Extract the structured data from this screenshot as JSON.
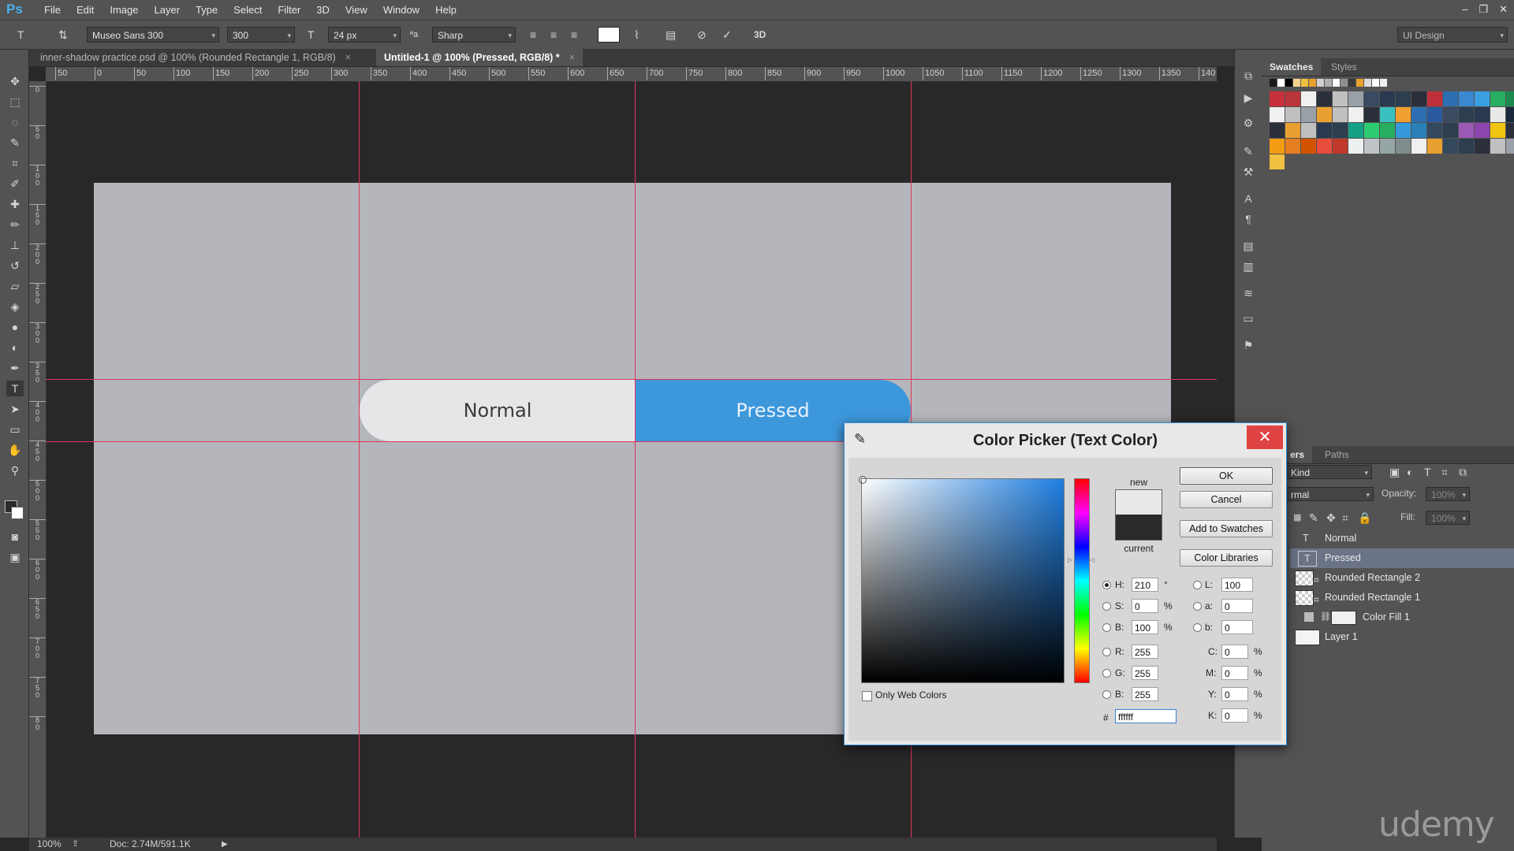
{
  "app": {
    "logo": "Ps",
    "menu": [
      "File",
      "Edit",
      "Image",
      "Layer",
      "Type",
      "Select",
      "Filter",
      "3D",
      "View",
      "Window",
      "Help"
    ],
    "window_controls": [
      "–",
      "❐",
      "✕"
    ]
  },
  "options_bar": {
    "font_family": "Museo Sans 300",
    "font_style": "300",
    "font_size": "24 px",
    "aa_label": "ªa",
    "antialias": "Sharp",
    "three_d": "3D",
    "workspace": "UI Design",
    "text_color": "#ffffff"
  },
  "tabs": [
    {
      "label": "inner-shadow practice.psd @ 100% (Rounded Rectangle 1, RGB/8)",
      "close": "×"
    },
    {
      "label": "Untitled-1 @ 100% (Pressed, RGB/8) *",
      "close": "×"
    }
  ],
  "ruler": {
    "h_ticks": [
      "50",
      "0",
      "50",
      "100",
      "150",
      "200",
      "250",
      "300",
      "350",
      "400",
      "450",
      "500",
      "550",
      "600",
      "650",
      "700",
      "750",
      "800",
      "850",
      "900",
      "950",
      "1000",
      "1050",
      "1100",
      "1150",
      "1200",
      "1250",
      "1300",
      "1350",
      "140"
    ],
    "v_ticks": [
      "0",
      "5 0",
      "1 0 0",
      "1 5 0",
      "2 0 0",
      "2 5 0",
      "3 0 0",
      "3 5 0",
      "4 0 0",
      "4 5 0",
      "5 0 0",
      "5 5 0",
      "6 0 0",
      "6 5 0",
      "7 0 0",
      "7 5 0",
      "8 0"
    ]
  },
  "canvas": {
    "button_normal_label": "Normal",
    "button_pressed_label": "Pressed",
    "canvas_color": "#b4b6bc",
    "normal_color": "#e6e6e8",
    "pressed_color": "#3d97db",
    "guide_color": "#e0355b"
  },
  "status": {
    "zoom": "100%",
    "doc": "Doc: 2.74M/591.1K"
  },
  "panels": {
    "top_tabs": [
      "Swatches",
      "Styles"
    ],
    "layer_tabs": [
      "ers",
      "Paths"
    ],
    "kind_label": "Kind",
    "blend_mode": "rmal",
    "opacity_label": "Opacity:",
    "opacity_value": "100%",
    "fill_label": "Fill:",
    "fill_value": "100%",
    "layers": [
      {
        "name": "Normal",
        "type": "text"
      },
      {
        "name": "Pressed",
        "type": "text",
        "selected": true
      },
      {
        "name": "Rounded Rectangle 2",
        "type": "shape"
      },
      {
        "name": "Rounded Rectangle 1",
        "type": "shape"
      },
      {
        "name": "Color Fill 1",
        "type": "fill"
      },
      {
        "name": "Layer 1",
        "type": "pixel"
      }
    ],
    "watermark": "udemy"
  },
  "color_picker": {
    "title": "Color Picker (Text Color)",
    "buttons": {
      "ok": "OK",
      "cancel": "Cancel",
      "add_swatches": "Add to Swatches",
      "libraries": "Color Libraries"
    },
    "new_label": "new",
    "current_label": "current",
    "new_color": "#e8e8e8",
    "current_color": "#2a2a2a",
    "only_web_colors": "Only Web Colors",
    "hsb": {
      "h_label": "H:",
      "h": "210",
      "h_unit": "°",
      "s_label": "S:",
      "s": "0",
      "s_unit": "%",
      "b_label": "B:",
      "b": "100",
      "b_unit": "%"
    },
    "rgb": {
      "r_label": "R:",
      "r": "255",
      "g_label": "G:",
      "g": "255",
      "b_label": "B:",
      "b": "255"
    },
    "lab": {
      "l_label": "L:",
      "l": "100",
      "a_label": "a:",
      "a": "0",
      "b_label": "b:",
      "b": "0"
    },
    "cmyk": {
      "c_label": "C:",
      "c": "0",
      "m_label": "M:",
      "m": "0",
      "y_label": "Y:",
      "y": "0",
      "k_label": "K:",
      "k": "0",
      "unit": "%"
    },
    "hex_label": "#",
    "hex": "ffffff"
  }
}
